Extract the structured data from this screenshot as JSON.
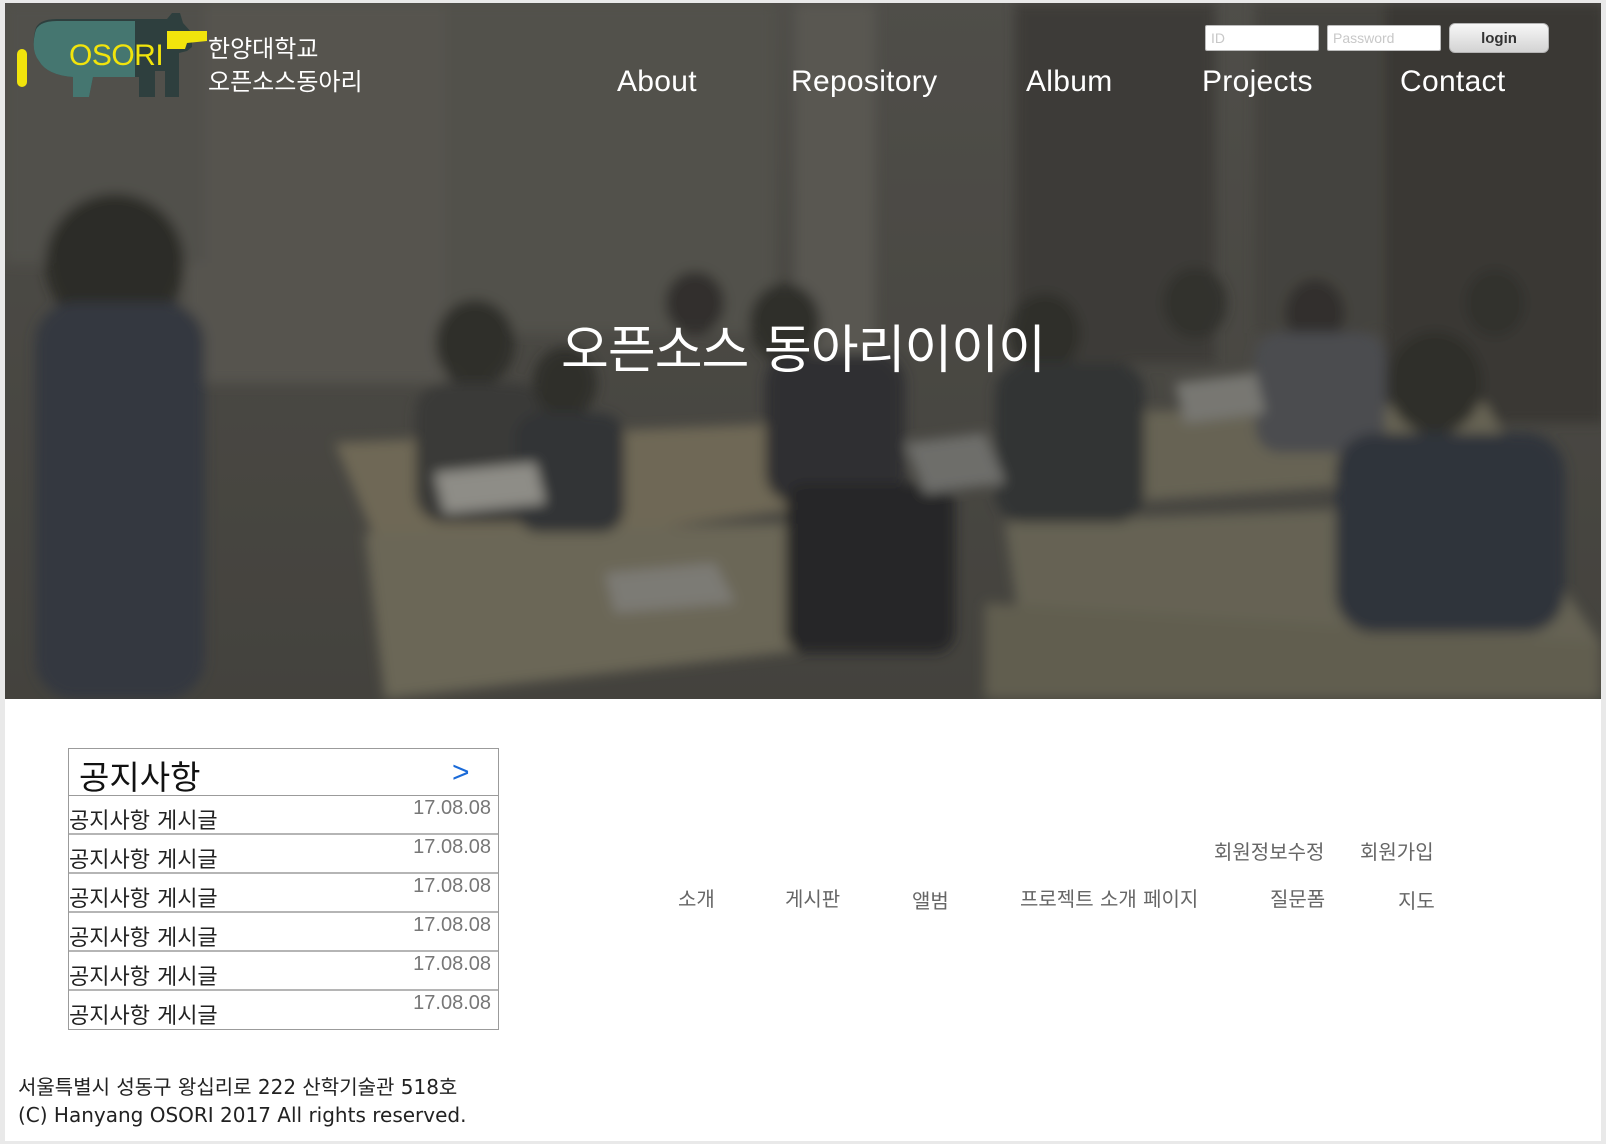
{
  "header": {
    "logo_text": "OSORI",
    "org_name_line1": "한양대학교",
    "org_name_line2": "오픈소스동아리",
    "login": {
      "id_placeholder": "ID",
      "password_placeholder": "Password",
      "button_label": "login"
    },
    "nav": [
      "About",
      "Repository",
      "Album",
      "Projects",
      "Contact"
    ]
  },
  "hero": {
    "title": "오픈소스 동아리이이이"
  },
  "notice": {
    "title": "공지사항",
    "more_label": ">",
    "items": [
      {
        "title": "공지사항 게시글",
        "date": "17.08.08"
      },
      {
        "title": "공지사항 게시글",
        "date": "17.08.08"
      },
      {
        "title": "공지사항 게시글",
        "date": "17.08.08"
      },
      {
        "title": "공지사항 게시글",
        "date": "17.08.08"
      },
      {
        "title": "공지사항 게시글",
        "date": "17.08.08"
      },
      {
        "title": "공지사항 게시글",
        "date": "17.08.08"
      }
    ]
  },
  "footer_links": {
    "account": [
      "회원정보수정",
      "회원가입"
    ],
    "sitemap": [
      "소개",
      "게시판",
      "앨범",
      "프로젝트 소개 페이지",
      "질문폼",
      "지도"
    ]
  },
  "footer": {
    "address": "서울특별시 성동구 왕십리로 222 산학기술관 518호",
    "copyright": "(C) Hanyang OSORI 2017 All rights reserved."
  },
  "colors": {
    "logo_yellow": "#f1e40c",
    "more_arrow_blue": "#1a6ad8",
    "hero_overlay": "#3a3935"
  }
}
